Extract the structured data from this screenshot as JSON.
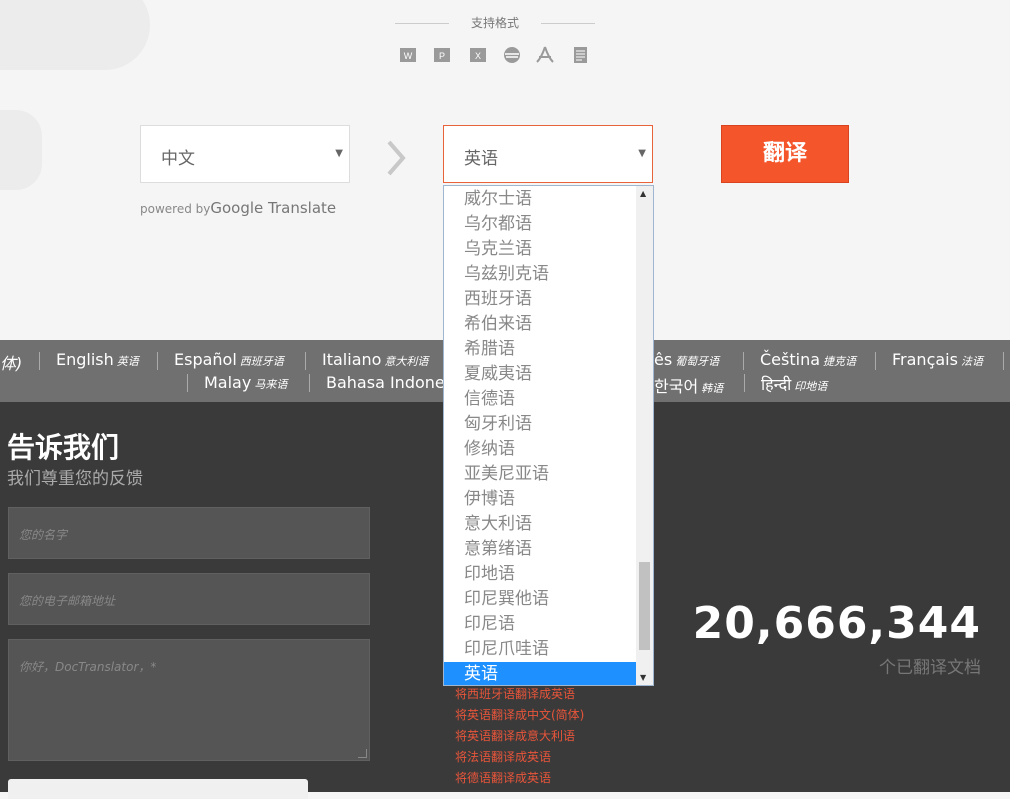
{
  "formats": {
    "title": "支持格式",
    "icons": [
      "word-icon",
      "powerpoint-icon",
      "excel-icon",
      "subtitle-icon",
      "pdf-icon",
      "text-file-icon"
    ]
  },
  "source_select": {
    "value": "中文"
  },
  "target_select": {
    "value": "英语"
  },
  "translate_button": {
    "label": "翻译"
  },
  "powered_by": {
    "prefix": "powered by",
    "brand": "Google",
    "suffix": " Translate"
  },
  "language_bar": {
    "row1": [
      {
        "name": "体)",
        "native": ""
      },
      {
        "name": "English",
        "native": "英语"
      },
      {
        "name": "Español",
        "native": "西班牙语"
      },
      {
        "name": "Italiano",
        "native": "意大利语"
      },
      {
        "name": "ês",
        "native": "葡萄牙语"
      },
      {
        "name": "Čeština",
        "native": "捷克语"
      },
      {
        "name": "Français",
        "native": "法语"
      }
    ],
    "row2": [
      {
        "name": "Malay",
        "native": "马来语"
      },
      {
        "name": "Bahasa Indones",
        "native": ""
      },
      {
        "name": "한국어",
        "native": "韩语"
      },
      {
        "name": "हिन्दी",
        "native": "印地语"
      }
    ]
  },
  "feedback": {
    "title": "告诉我们",
    "subtitle": "我们尊重您的反馈",
    "name_placeholder": "您的名字",
    "email_placeholder": "您的电子邮箱地址",
    "message_placeholder": "你好，DocTranslator，*"
  },
  "stats": {
    "count": "20,666,344",
    "label": "个已翻译文档"
  },
  "translate_links": [
    "将西班牙语翻译成英语",
    "将英语翻译成中文(简体)",
    "将英语翻译成意大利语",
    "将法语翻译成英语",
    "将德语翻译成英语"
  ],
  "dropdown": {
    "options": [
      "威尔士语",
      "乌尔都语",
      "乌克兰语",
      "乌兹别克语",
      "西班牙语",
      "希伯来语",
      "希腊语",
      "夏威夷语",
      "信德语",
      "匈牙利语",
      "修纳语",
      "亚美尼亚语",
      "伊博语",
      "意大利语",
      "意第绪语",
      "印地语",
      "印尼巽他语",
      "印尼语",
      "印尼爪哇语",
      "英语"
    ],
    "selected": "英语"
  },
  "colors": {
    "accent": "#f4552b",
    "link": "#e8553a",
    "selection": "#1e90ff",
    "dark_bg": "#3a3a3a",
    "bar_bg": "#707070"
  }
}
